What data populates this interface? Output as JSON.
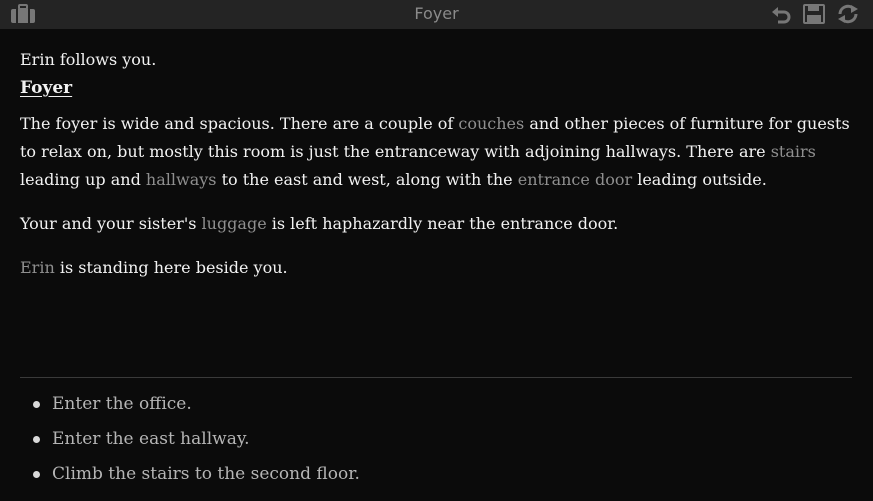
{
  "header": {
    "title": "Foyer",
    "icons": [
      "briefcase-icon",
      "undo-icon",
      "save-icon",
      "restart-icon"
    ]
  },
  "story": {
    "intro": "Erin follows you.",
    "room_name": "Foyer",
    "desc": {
      "t1": "The foyer is wide and spacious. There are a couple of ",
      "k1": "couches",
      "t2": " and other pieces of furniture for guests to relax on, but mostly this room is just the entranceway with adjoining hallways. There are ",
      "k2": "stairs",
      "t3": " leading up and ",
      "k3": "hallways",
      "t4": " to the east and west, along with the ",
      "k4": "entrance door",
      "t5": " leading outside."
    },
    "luggage": {
      "t1": "Your and your sister's ",
      "k1": "luggage",
      "t2": " is left haphazardly near the entrance door."
    },
    "erin": {
      "k1": "Erin",
      "t1": " is standing here beside you."
    }
  },
  "choices": [
    "Enter the office.",
    "Enter the east hallway.",
    "Climb the stairs to the second floor."
  ],
  "colors": {
    "background": "#0b0b0b",
    "topbar": "#242424",
    "text": "#f2f2f2",
    "keyword": "#8f8f8f",
    "choice": "#b5b5b5"
  }
}
